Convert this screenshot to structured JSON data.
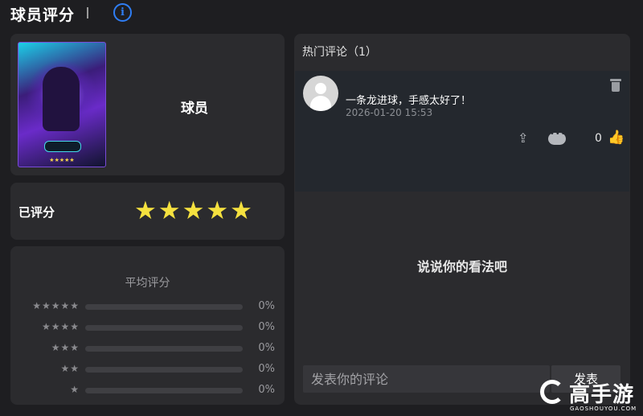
{
  "header": {
    "title": "球员评分",
    "info_icon": "info-circle-icon"
  },
  "player": {
    "name": "球员",
    "card_image": "player-card-image"
  },
  "rating": {
    "label": "已评分",
    "stars_text": "★★★★★",
    "value": 5,
    "max": 5
  },
  "average": {
    "title": "平均评分",
    "rows": [
      {
        "stars": "★★★★★",
        "percent": "0%",
        "fill": 0
      },
      {
        "stars": "★★★★",
        "percent": "0%",
        "fill": 0
      },
      {
        "stars": "★★★",
        "percent": "0%",
        "fill": 0
      },
      {
        "stars": "★★",
        "percent": "0%",
        "fill": 0
      },
      {
        "stars": "★",
        "percent": "0%",
        "fill": 0
      }
    ]
  },
  "comments": {
    "heading": "热门评论（1）",
    "items": [
      {
        "text": "一条龙进球，手感太好了！",
        "time": "2026-01-20 15:53",
        "likes": "0",
        "icons": [
          "avatar-icon",
          "trash-icon",
          "share-icon",
          "comment-icon",
          "thumbs-up-icon"
        ]
      }
    ],
    "empty_prompt": "说说你的看法吧",
    "input_placeholder": "发表你的评论",
    "post_label": "发表"
  },
  "watermark": {
    "name": "高手游",
    "domain": "GAOSHOUYOU.COM"
  },
  "colors": {
    "star": "#f5e13f",
    "info": "#2f7ef5",
    "panel": "#2b2b2e",
    "background": "#1e1e21"
  }
}
